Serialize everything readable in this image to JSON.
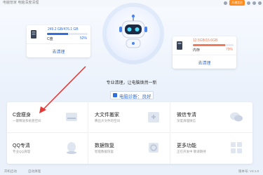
{
  "titlebar": {
    "brand": "电脑管家 电脑深度清理",
    "vip_label": "开通会员"
  },
  "disk_c": {
    "usage": "249.2 GB/476.1 GB",
    "name": "C盘",
    "percent": "52%",
    "fill": 0.52,
    "clean_label": "去清理",
    "accent": "#2f6fdd"
  },
  "memory": {
    "usage": "12.5GB/15.6GB",
    "name": "内存",
    "percent": "79%",
    "fill": 0.79,
    "clean_label": "去清理",
    "accent": "#f07a5a"
  },
  "hero": {
    "slogan": "专业清理，让电脑焕然一新",
    "status": "电脑诊断：良好"
  },
  "tools": [
    {
      "title": "C盘瘦身",
      "subtitle": "一键释放系统盘空间"
    },
    {
      "title": "大文件搬家",
      "subtitle": "腾出大文件的空间"
    },
    {
      "title": "微信专清",
      "subtitle": "深度清理微信"
    },
    {
      "title": "QQ专清",
      "subtitle": "专业QQ清理"
    },
    {
      "title": "数据恢复",
      "subtitle": "智能数据恢复"
    },
    {
      "title": "更多功能",
      "subtitle": "正在开发中 敬请期待"
    }
  ],
  "footer": {
    "left1": "开机启动",
    "left2": "自动清理",
    "right": "版本号: V3.1.0"
  }
}
